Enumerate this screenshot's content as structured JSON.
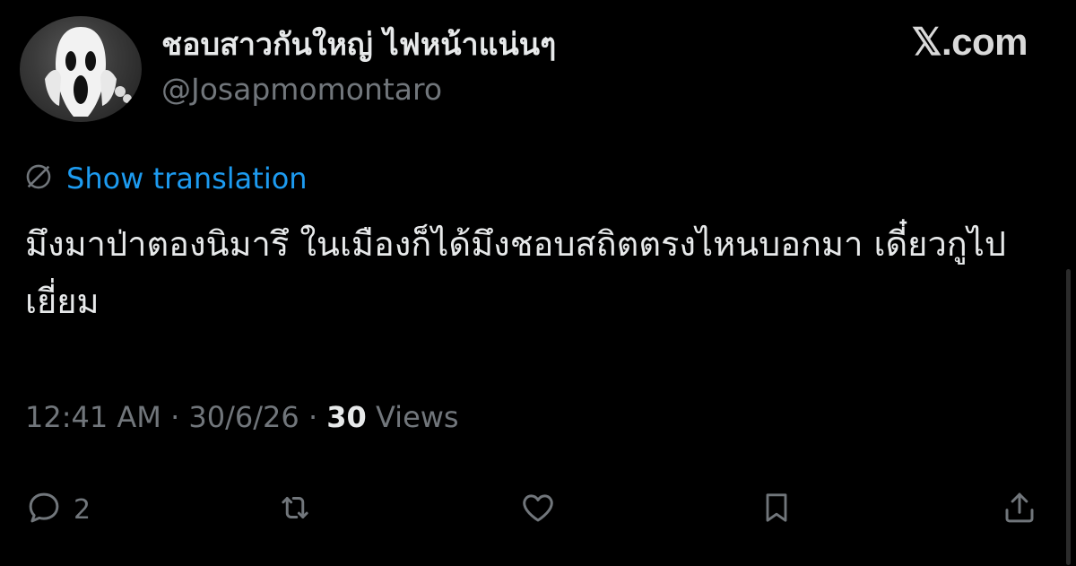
{
  "author": {
    "display_name": "ชอบสาวกันใหญ่ ไฟหน้าแน่นๆ",
    "handle": "@Josapmomontaro",
    "avatar_icon": "ghostface-mask-avatar"
  },
  "brand": {
    "label": "𝕏.com"
  },
  "translation": {
    "label": "Show translation",
    "icon": "globe-icon"
  },
  "tweet": {
    "text": "มึงมาป่าตองนิมารึ ในเมืองก็ได้มึงชอบสถิตตรงไหนบอกมา เดี๋ยวกูไปเยี่ยม"
  },
  "meta": {
    "time": "12:41 AM",
    "sep1": " · ",
    "date": "30/6/26",
    "sep2": " · ",
    "views_count": "30",
    "views_label": " Views"
  },
  "actions": {
    "reply_count": "2"
  },
  "colors": {
    "background": "#000000",
    "text": "#e7e9ea",
    "muted": "#71767b",
    "link": "#1d9bf0"
  }
}
